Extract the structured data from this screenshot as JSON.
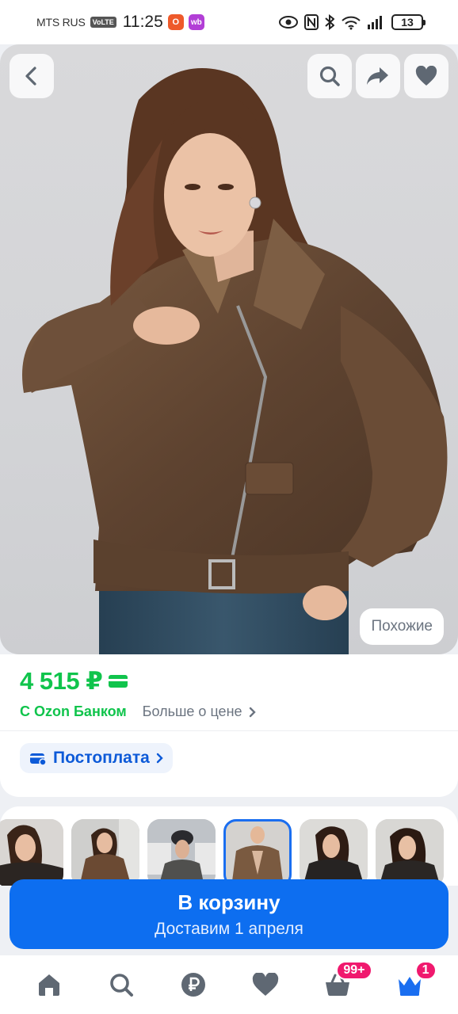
{
  "status_bar": {
    "carrier": "MTS RUS",
    "volte": "VoLTE",
    "time": "11:25",
    "app_badge_1": "O",
    "app_badge_2": "wb",
    "battery": "13"
  },
  "hero": {
    "similar_label": "Похожие",
    "icons": [
      "back-icon",
      "search-icon",
      "share-icon",
      "heart-icon"
    ]
  },
  "price": {
    "value": "4 515 ₽",
    "bank_label": "С Ozon Банком",
    "more_price": "Больше о цене",
    "accent_color": "#10c44c"
  },
  "postpay": {
    "label": "Постоплата"
  },
  "thumbnails": {
    "count": 6,
    "selected_index": 3
  },
  "cart": {
    "title": "В корзину",
    "subtitle": "Доставим 1 апреля",
    "color": "#0d6ef0"
  },
  "nav": {
    "items": [
      "home",
      "search",
      "finance",
      "favorites",
      "cart",
      "profile"
    ],
    "cart_badge": "99+",
    "profile_badge": "1"
  }
}
